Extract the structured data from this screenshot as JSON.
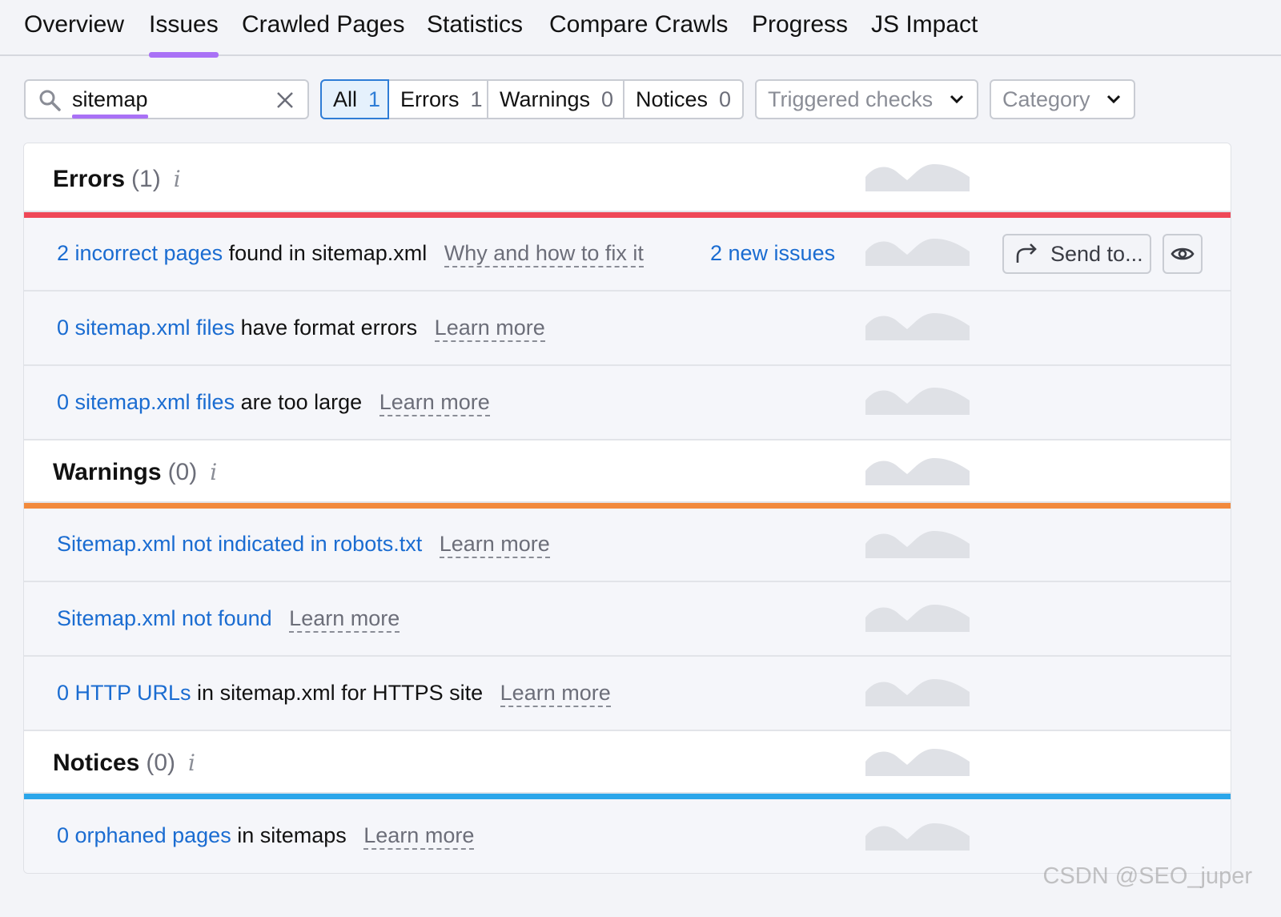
{
  "tabs": [
    {
      "label": "Overview"
    },
    {
      "label": "Issues",
      "active": true
    },
    {
      "label": "Crawled Pages"
    },
    {
      "label": "Statistics"
    },
    {
      "label": "Compare Crawls"
    },
    {
      "label": "Progress"
    },
    {
      "label": "JS Impact"
    }
  ],
  "search": {
    "value": "sitemap"
  },
  "filters": {
    "all": {
      "label": "All",
      "count": "1"
    },
    "errors": {
      "label": "Errors",
      "count": "1"
    },
    "warnings": {
      "label": "Warnings",
      "count": "0"
    },
    "notices": {
      "label": "Notices",
      "count": "0"
    }
  },
  "dropdowns": {
    "triggered_checks": "Triggered checks",
    "category": "Category"
  },
  "colors": {
    "accent": "#a971f6",
    "link": "#1a6cd1",
    "errors_bar": "#ef4757",
    "warnings_bar": "#f28a3c",
    "notices_bar": "#2ba6ea"
  },
  "sections": {
    "errors": {
      "title": "Errors",
      "count": "(1)",
      "info": "i",
      "items": [
        {
          "link": "2 incorrect pages",
          "text": " found in sitemap.xml",
          "help": "Why and how to fix it",
          "new_issues": "2 new issues",
          "send": "Send to..."
        },
        {
          "link": "0 sitemap.xml files",
          "text": " have format errors",
          "help": "Learn more"
        },
        {
          "link": "0 sitemap.xml files",
          "text": " are too large",
          "help": "Learn more"
        }
      ]
    },
    "warnings": {
      "title": "Warnings",
      "count": "(0)",
      "info": "i",
      "items": [
        {
          "link": "Sitemap.xml not indicated in robots.txt",
          "text": "",
          "help": "Learn more"
        },
        {
          "link": "Sitemap.xml not found",
          "text": "",
          "help": "Learn more"
        },
        {
          "link": "0 HTTP URLs",
          "text": " in sitemap.xml for HTTPS site",
          "help": "Learn more"
        }
      ]
    },
    "notices": {
      "title": "Notices",
      "count": "(0)",
      "info": "i",
      "items": [
        {
          "link": "0 orphaned pages",
          "text": " in sitemaps",
          "help": "Learn more"
        }
      ]
    }
  },
  "watermark": "CSDN @SEO_juper"
}
